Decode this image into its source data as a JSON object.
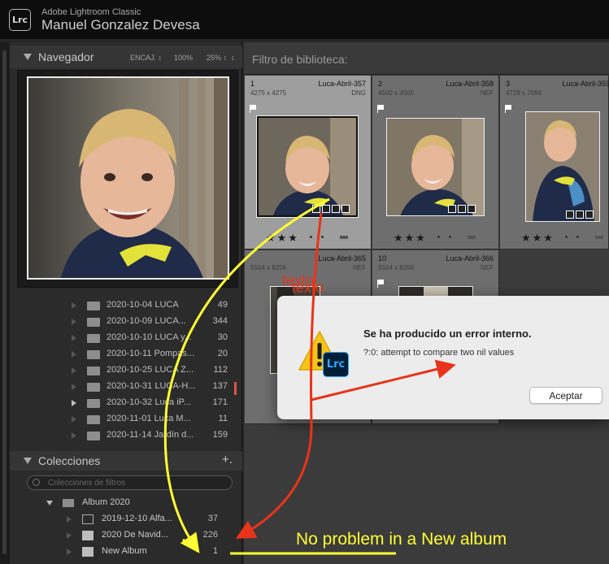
{
  "app": {
    "badge": "Lrc",
    "product_name": "Adobe Lightroom Classic",
    "user_name": "Manuel Gonzalez Devesa"
  },
  "navigator": {
    "title": "Navegador",
    "fit_option": "ENCAJ. ↕",
    "zoom_100": "100%",
    "zoom_25": "25% ↕",
    "menu": "↕"
  },
  "folders": [
    {
      "name": "2020-10-04 LUCA",
      "count": "49",
      "expanded": false
    },
    {
      "name": "2020-10-09 LUCA...",
      "count": "344",
      "expanded": false
    },
    {
      "name": "2020-10-10 LUCA y...",
      "count": "30",
      "expanded": false
    },
    {
      "name": "2020-10-11 Pompas...",
      "count": "20",
      "expanded": false
    },
    {
      "name": "2020-10-25 LUCA Z...",
      "count": "112",
      "expanded": false
    },
    {
      "name": "2020-10-31 LUCA-H...",
      "count": "137",
      "expanded": false
    },
    {
      "name": "2020-10-32 Luca iP...",
      "count": "171",
      "expanded": true
    },
    {
      "name": "2020-11-01 Luca M...",
      "count": "11",
      "expanded": false
    },
    {
      "name": "2020-11-14 Jardín d...",
      "count": "159",
      "expanded": false
    }
  ],
  "collections": {
    "title": "Colecciones",
    "add_label": "+.",
    "search_placeholder": "Colecciones de filtros",
    "items": [
      {
        "name": "Album 2020",
        "count": "",
        "kind": "set"
      },
      {
        "name": "2019-12-10 Alfa...",
        "count": "37",
        "kind": "smart"
      },
      {
        "name": "2020 De Navid...",
        "count": "226",
        "kind": "collection"
      },
      {
        "name": "New Album",
        "count": "1",
        "kind": "collection"
      }
    ]
  },
  "library": {
    "filter_label": "Filtro de biblioteca:",
    "cells": [
      {
        "num": "1",
        "file": "Luca-Abril-357",
        "dims": "4275 x 4275",
        "ext": "DNG",
        "stars": "★★★"
      },
      {
        "num": "2",
        "file": "Luca-Abril-358",
        "dims": "4500 x 4500",
        "ext": "NEF",
        "stars": "★★★"
      },
      {
        "num": "3",
        "file": "Luca-Abril-359",
        "dims": "4729 x 7094",
        "ext": "",
        "stars": "★★★"
      },
      {
        "num": "",
        "file": "Luca-Abril-365",
        "dims": "5504 x 8256",
        "ext": "NEF",
        "stars": "★★★"
      },
      {
        "num": "10",
        "file": "Luca-Abril-366",
        "dims": "5504 x 8256",
        "ext": "NEF",
        "stars": "★★★"
      }
    ]
  },
  "dialog": {
    "title": "Se ha producido un error interno.",
    "message": "?:0: attempt to compare two nil values",
    "ok_label": "Aceptar",
    "app_icon": "Lrc",
    "icon": "warning-icon"
  },
  "annotations": {
    "note_big": "No problem in a New album",
    "note_small_1": "texto",
    "note_small_2": "texto",
    "colors": {
      "yellow": "#ffff33",
      "red": "#e8341a"
    }
  }
}
